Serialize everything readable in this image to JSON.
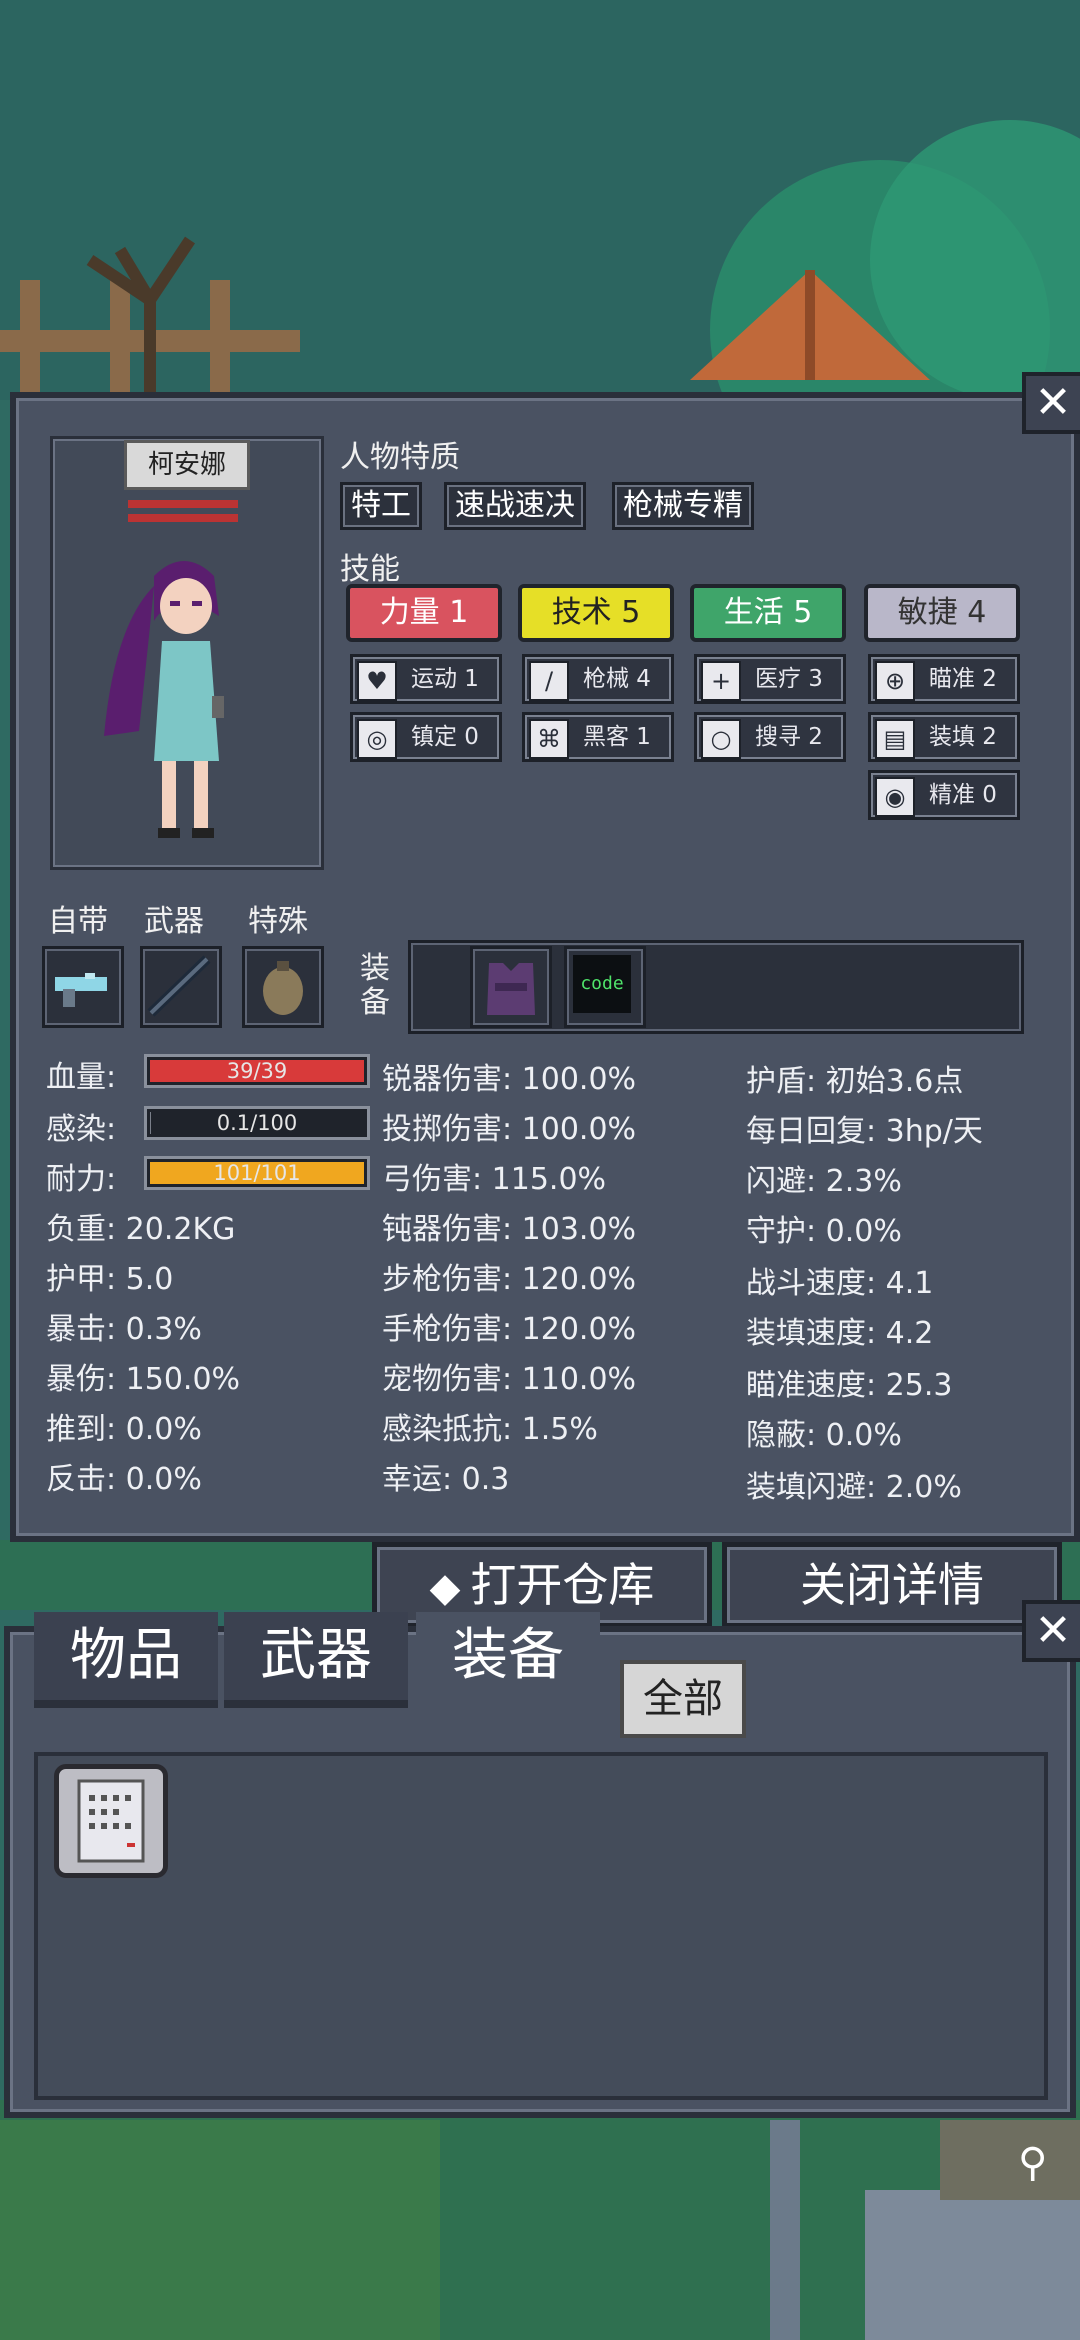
{
  "character": {
    "name": "柯安娜",
    "traits_header": "人物特质",
    "traits": [
      "特工",
      "速战速决",
      "枪械专精"
    ],
    "skills_header": "技能",
    "skills": [
      {
        "label": "力量 1",
        "color": "#d9535f",
        "subs": [
          {
            "icon": "heart-icon",
            "glyph": "♥",
            "label": "运动 1"
          },
          {
            "icon": "glasses-icon",
            "glyph": "◎",
            "label": "镇定 0"
          }
        ]
      },
      {
        "label": "技术 5",
        "color": "#e6df27",
        "subs": [
          {
            "icon": "knife-icon",
            "glyph": "/",
            "label": "枪械 4"
          },
          {
            "icon": "circuit-icon",
            "glyph": "⌘",
            "label": "黑客 1"
          }
        ]
      },
      {
        "label": "生活 5",
        "color": "#3fa56a",
        "subs": [
          {
            "icon": "medkit-icon",
            "glyph": "+",
            "label": "医疗 3"
          },
          {
            "icon": "magnifier-icon",
            "glyph": "○",
            "label": "搜寻 2"
          }
        ]
      },
      {
        "label": "敏捷 4",
        "color": "#b9b7c9",
        "subs": [
          {
            "icon": "crosshair-icon",
            "glyph": "⊕",
            "label": "瞄准 2"
          },
          {
            "icon": "magazine-icon",
            "glyph": "▤",
            "label": "装填 2"
          },
          {
            "icon": "eye-icon",
            "glyph": "◉",
            "label": "精准 0"
          }
        ]
      }
    ]
  },
  "equipment": {
    "slot_labels": [
      "自带",
      "武器",
      "特殊"
    ],
    "gear_label": "装备",
    "code_text": "code"
  },
  "stats": {
    "bars": [
      {
        "label": "血量:",
        "value": "39/39",
        "fraction": 1.0,
        "color": "#d83a3a"
      },
      {
        "label": "感染:",
        "value": "0.1/100",
        "fraction": 0.001,
        "color": "#7a7f8a"
      },
      {
        "label": "耐力:",
        "value": "101/101",
        "fraction": 1.0,
        "color": "#f0a71f"
      }
    ],
    "col1": [
      "负重: 20.2KG",
      "护甲: 5.0",
      "暴击: 0.3%",
      "暴伤: 150.0%",
      "推到: 0.0%",
      "反击: 0.0%"
    ],
    "col2": [
      "锐器伤害: 100.0%",
      "投掷伤害: 100.0%",
      "弓伤害: 115.0%",
      "钝器伤害: 103.0%",
      "步枪伤害: 120.0%",
      "手枪伤害: 120.0%",
      "宠物伤害: 110.0%",
      "感染抵抗: 1.5%",
      "幸运: 0.3"
    ],
    "col3": [
      "护盾: 初始3.6点",
      "每日回复: 3hp/天",
      "闪避: 2.3%",
      "守护: 0.0%",
      "战斗速度: 4.1",
      "装填速度: 4.2",
      "瞄准速度: 25.3",
      "隐蔽: 0.0%",
      "装填闪避: 2.0%"
    ]
  },
  "buttons": {
    "open_storage": "打开仓库",
    "close_details": "关闭详情"
  },
  "inventory": {
    "tabs": [
      "物品",
      "武器",
      "装备"
    ],
    "filter": "全部",
    "item_icon": "document-icon"
  },
  "colors": {
    "panel": "#4a5262",
    "accent_red": "#d9535f",
    "accent_yellow": "#e6df27",
    "accent_green": "#3fa56a"
  }
}
